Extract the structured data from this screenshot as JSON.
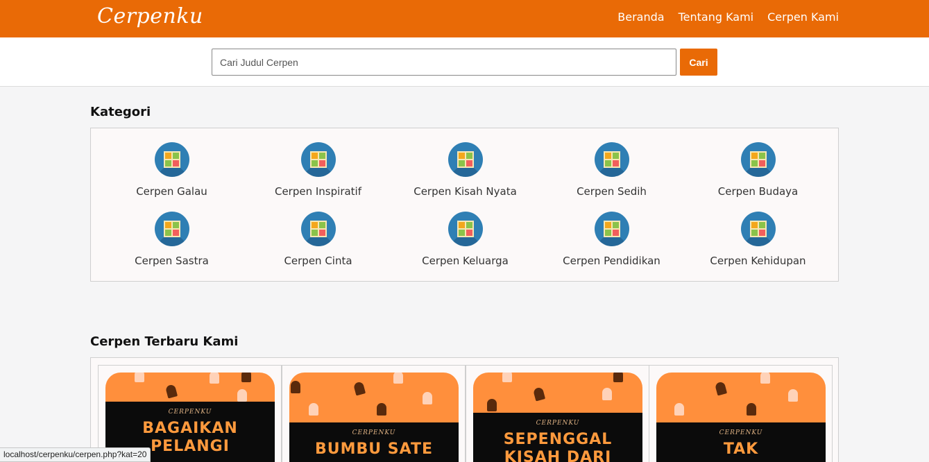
{
  "navbar": {
    "brand": "Cerpenku",
    "links": [
      "Beranda",
      "Tentang Kami",
      "Cerpen Kami"
    ]
  },
  "search": {
    "placeholder": "Cari Judul Cerpen",
    "value": "",
    "button_label": "Cari"
  },
  "kategori": {
    "title": "Kategori",
    "icon": "category-grid-icon",
    "items": [
      "Cerpen Galau",
      "Cerpen Inspiratif",
      "Cerpen Kisah Nyata",
      "Cerpen Sedih",
      "Cerpen Budaya",
      "Cerpen Sastra",
      "Cerpen Cinta",
      "Cerpen Keluarga",
      "Cerpen Pendidikan",
      "Cerpen Kehidupan"
    ]
  },
  "terbaru": {
    "title": "Cerpen Terbaru Kami",
    "cards": [
      {
        "brand": "CERPENKU",
        "title": "BAGAIKAN PELANGI"
      },
      {
        "brand": "CERPENKU",
        "title": "BUMBU SATE"
      },
      {
        "brand": "CERPENKU",
        "title": "SEPENGGAL KISAH DARI"
      },
      {
        "brand": "CERPENKU",
        "title": "TAK"
      }
    ]
  },
  "status_bar": {
    "url": "localhost/cerpenku/cerpen.php?kat=20"
  },
  "colors": {
    "accent": "#e96a06",
    "cover_orange": "#ff8f3c",
    "cover_band": "#0b0b0b",
    "icon_blue": "#2f7fb4"
  }
}
